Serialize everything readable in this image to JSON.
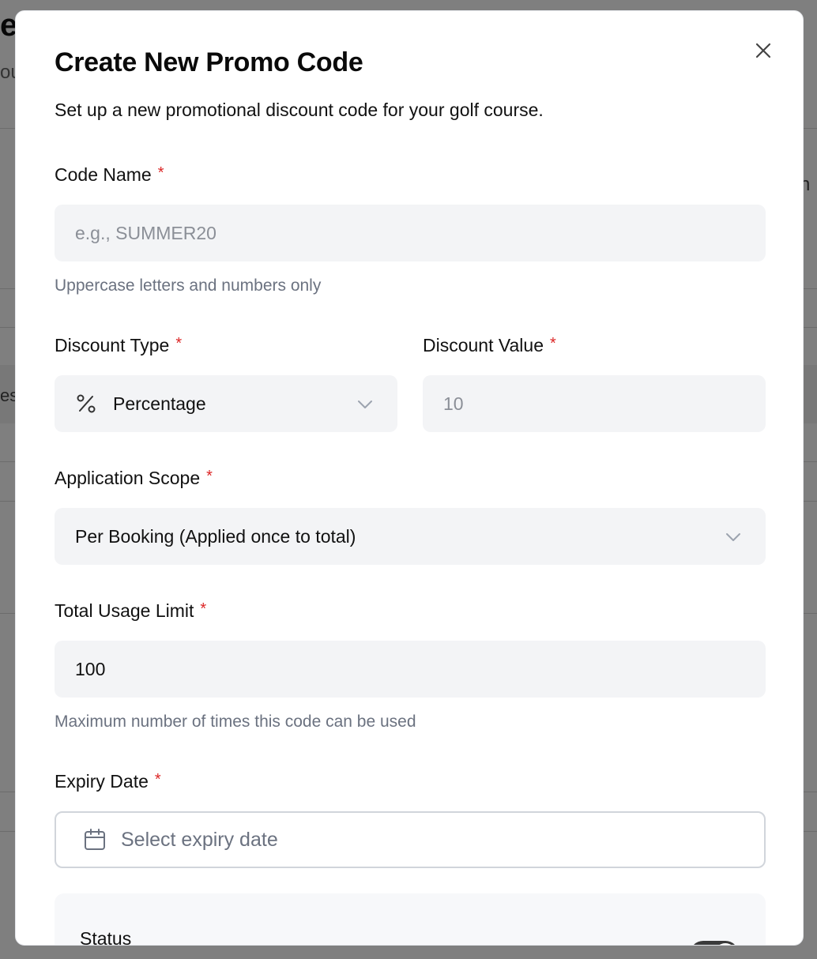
{
  "background": {
    "title_fragment": "e",
    "subtitle_fragment": "ou",
    "right_fragment": "n",
    "left_fragment": "es"
  },
  "modal": {
    "title": "Create New Promo Code",
    "description": "Set up a new promotional discount code for your golf course.",
    "required_marker": "*",
    "code_name": {
      "label": "Code Name",
      "placeholder": "e.g., SUMMER20",
      "hint": "Uppercase letters and numbers only"
    },
    "discount_type": {
      "label": "Discount Type",
      "value": "Percentage",
      "icon": "percent-icon"
    },
    "discount_value": {
      "label": "Discount Value",
      "placeholder": "10"
    },
    "application_scope": {
      "label": "Application Scope",
      "value": "Per Booking (Applied once to total)"
    },
    "usage_limit": {
      "label": "Total Usage Limit",
      "value": "100",
      "hint": "Maximum number of times this code can be used"
    },
    "expiry_date": {
      "label": "Expiry Date",
      "placeholder": "Select expiry date",
      "icon": "calendar-icon"
    },
    "status": {
      "label": "Status",
      "enabled": true
    }
  },
  "colors": {
    "required": "#dc2626",
    "field_bg": "#f3f4f6",
    "hint": "#6b7280",
    "toggle_on": "#3a3a3a"
  }
}
